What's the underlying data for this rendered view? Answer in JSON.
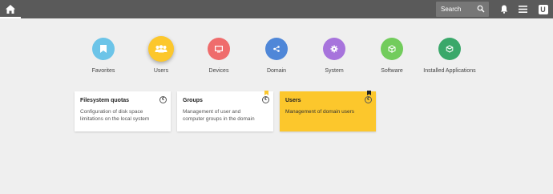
{
  "header": {
    "search_placeholder": "Search",
    "icons": [
      "home-icon",
      "search-icon",
      "bell-icon",
      "menu-icon",
      "user-icon"
    ],
    "user_initial": "U",
    "bar_color": "#5a5a5a"
  },
  "categories": [
    {
      "label": "Favorites",
      "color": "#6cc4e8",
      "icon": "bookmark-icon"
    },
    {
      "label": "Users",
      "color": "#fcc72c",
      "icon": "users-icon",
      "active": true
    },
    {
      "label": "Devices",
      "color": "#ef6c6c",
      "icon": "monitor-icon"
    },
    {
      "label": "Domain",
      "color": "#4f87d8",
      "icon": "network-icon"
    },
    {
      "label": "System",
      "color": "#a774dc",
      "icon": "gear-icon"
    },
    {
      "label": "Software",
      "color": "#72cc5c",
      "icon": "package-icon"
    },
    {
      "label": "Installed Applications",
      "color": "#3aa86a",
      "icon": "box-icon"
    }
  ],
  "tiles": [
    {
      "title": "Filesystem quotas",
      "description": "Configuration of disk space limitations on the local system",
      "info_glyph": "€"
    },
    {
      "title": "Groups",
      "description": "Management of user and computer groups in the domain",
      "info_glyph": "€",
      "bookmark_color": "#fcc72c"
    },
    {
      "title": "Users",
      "description": "Management of domain users",
      "info_glyph": "€",
      "bookmark_color": "#222222",
      "selected": true
    }
  ]
}
